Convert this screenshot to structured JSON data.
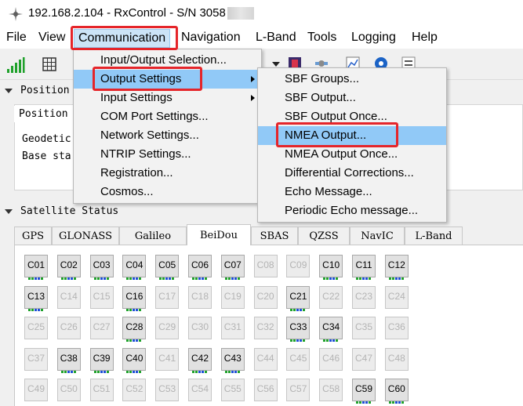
{
  "window": {
    "title": "192.168.2.104 - RxControl - S/N 3058"
  },
  "menubar": {
    "items": [
      {
        "label": "File"
      },
      {
        "label": "View"
      },
      {
        "label": "Communication"
      },
      {
        "label": "Navigation"
      },
      {
        "label": "L-Band"
      },
      {
        "label": "Tools"
      },
      {
        "label": "Logging"
      },
      {
        "label": "Help"
      }
    ]
  },
  "position_section": {
    "header": "Position",
    "tab": "Position",
    "labels": [
      "Geodetic",
      "Base sta"
    ]
  },
  "satellite_section": {
    "header": "Satellite Status",
    "tabs": [
      "GPS",
      "GLONASS",
      "Galileo",
      "BeiDou",
      "SBAS",
      "QZSS",
      "NavIC",
      "L-Band"
    ],
    "selected_tab": "BeiDou",
    "satellites": [
      [
        "C01",
        "C02",
        "C03",
        "C04",
        "C05",
        "C06",
        "C07",
        "C08",
        "C09",
        "C10",
        "C11",
        "C12"
      ],
      [
        "C13",
        "C14",
        "C15",
        "C16",
        "C17",
        "C18",
        "C19",
        "C20",
        "C21",
        "C22",
        "C23",
        "C24"
      ],
      [
        "C25",
        "C26",
        "C27",
        "C28",
        "C29",
        "C30",
        "C31",
        "C32",
        "C33",
        "C34",
        "C35",
        "C36"
      ],
      [
        "C37",
        "C38",
        "C39",
        "C40",
        "C41",
        "C42",
        "C43",
        "C44",
        "C45",
        "C46",
        "C47",
        "C48"
      ],
      [
        "C49",
        "C50",
        "C51",
        "C52",
        "C53",
        "C54",
        "C55",
        "C56",
        "C57",
        "C58",
        "C59",
        "C60"
      ]
    ],
    "active": [
      "C01",
      "C02",
      "C03",
      "C04",
      "C05",
      "C06",
      "C07",
      "C10",
      "C11",
      "C12",
      "C13",
      "C16",
      "C21",
      "C28",
      "C33",
      "C34",
      "C38",
      "C39",
      "C40",
      "C42",
      "C43",
      "C59",
      "C60"
    ]
  },
  "communication_menu": {
    "items": [
      {
        "label": "Input/Output Selection...",
        "submenu": false
      },
      {
        "label": "Output Settings",
        "submenu": true
      },
      {
        "label": "Input Settings",
        "submenu": true
      },
      {
        "label": "COM Port Settings...",
        "submenu": false
      },
      {
        "label": "Network Settings...",
        "submenu": false
      },
      {
        "label": "NTRIP Settings...",
        "submenu": false
      },
      {
        "label": "Registration...",
        "submenu": false
      },
      {
        "label": "Cosmos...",
        "submenu": false
      }
    ]
  },
  "output_settings_menu": {
    "items": [
      {
        "label": "SBF Groups..."
      },
      {
        "label": "SBF Output..."
      },
      {
        "label": "SBF Output Once..."
      },
      {
        "label": "NMEA Output..."
      },
      {
        "label": "NMEA Output Once..."
      },
      {
        "label": "Differential Corrections..."
      },
      {
        "label": "Echo Message..."
      },
      {
        "label": "Periodic Echo message..."
      }
    ]
  },
  "colors": {
    "highlight": "#91c9f7",
    "annotation": "#e5252a",
    "signal_green": "#1fa12b",
    "signal_blue": "#1e4fd6"
  }
}
